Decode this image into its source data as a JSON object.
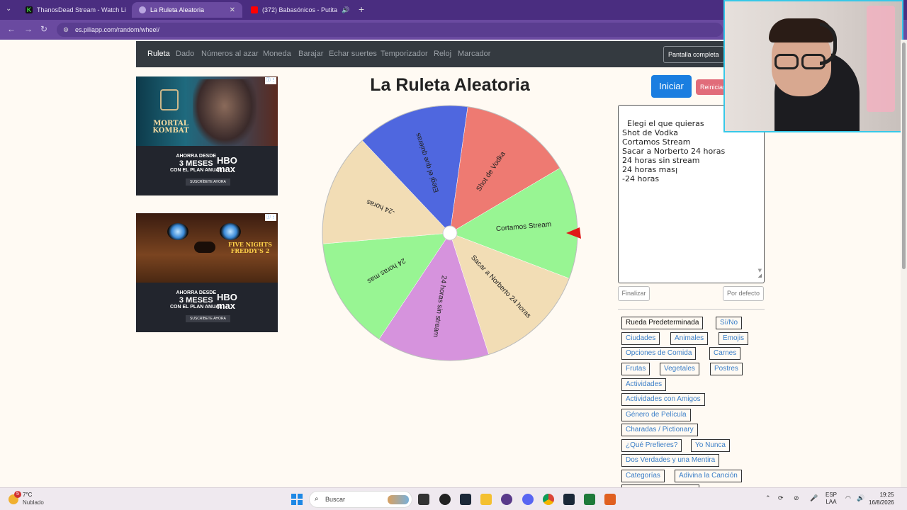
{
  "browser": {
    "tabs": [
      {
        "title": "ThanosDead Stream - Watch Li",
        "active": false,
        "color": "#3dd63d"
      },
      {
        "title": "La Ruleta Aleatoria",
        "active": true,
        "color": "#b9a6e0"
      },
      {
        "title": "(372) Babasónicos - Putita",
        "active": false,
        "color": "#ff0000"
      }
    ],
    "url": "es.piliapp.com/random/wheel/"
  },
  "site_nav": {
    "items": [
      "Ruleta",
      "Dado",
      "Números al azar",
      "Moneda",
      "Barajar",
      "Echar suertes",
      "Temporizador",
      "Reloj",
      "Marcador"
    ],
    "current": "Ruleta",
    "fullscreen_label": "Pantalla completa"
  },
  "ads": [
    {
      "headline": "MORTAL KOMBAT",
      "promo_line1": "AHORRA DESDE",
      "promo_line2": "3 MESES",
      "promo_line3": "CON EL PLAN ANUAL",
      "brand1": "HBO",
      "brand2": "max",
      "cta": "SUSCRÍBETE AHORA"
    },
    {
      "headline": "FIVE NIGHTS FREDDY'S 2",
      "promo_line1": "AHORRA DESDE",
      "promo_line2": "3 MESES",
      "promo_line3": "CON EL PLAN ANUAL",
      "brand1": "HBO",
      "brand2": "max",
      "cta": "SUSCRÍBETE AHORA"
    }
  ],
  "main": {
    "title": "La Ruleta Aleatoria",
    "start_label": "Iniciar",
    "reset_label": "Reiniciar",
    "entries_text": "Elegi el que quieras\nShot de Vodka\nCortamos Stream\nSacar a Norberto 24 horas\n24 horas sin stream\n24 horas mas\n-24 horas",
    "finish_label": "Finalizar",
    "default_label": "Por defecto"
  },
  "wheel": {
    "segments": [
      {
        "label": "Shot de Vodka",
        "color": "#ee7a72"
      },
      {
        "label": "Cortamos Stream",
        "color": "#98f593"
      },
      {
        "label": "Sacar a Norberto 24 horas",
        "color": "#f2ddb5"
      },
      {
        "label": "24 horas sin stream",
        "color": "#d693dd"
      },
      {
        "label": "24 horas mas",
        "color": "#98f593"
      },
      {
        "label": "-24 horas",
        "color": "#f2ddb5"
      },
      {
        "label": "Elegi el que quieras",
        "color": "#4f67df"
      }
    ],
    "pointer_color": "#e01818"
  },
  "presets": [
    {
      "label": "Rueda Predeterminada",
      "selected": true
    },
    {
      "label": "Sí/No",
      "selected": false
    },
    {
      "label": "Ciudades",
      "selected": false
    },
    {
      "label": "Animales",
      "selected": false
    },
    {
      "label": "Emojis",
      "selected": false
    },
    {
      "label": "Opciones de Comida",
      "selected": false
    },
    {
      "label": "Carnes",
      "selected": false
    },
    {
      "label": "Frutas",
      "selected": false
    },
    {
      "label": "Vegetales",
      "selected": false
    },
    {
      "label": "Postres",
      "selected": false
    },
    {
      "label": "Actividades",
      "selected": false
    },
    {
      "label": "Actividades con Amigos",
      "selected": false
    },
    {
      "label": "Género de Película",
      "selected": false
    },
    {
      "label": "Charadas / Pictionary",
      "selected": false
    },
    {
      "label": "¿Qué Prefieres?",
      "selected": false
    },
    {
      "label": "Yo Nunca",
      "selected": false
    },
    {
      "label": "Dos Verdades y una Mentira",
      "selected": false
    },
    {
      "label": "Categorías",
      "selected": false
    },
    {
      "label": "Adivina la Canción",
      "selected": false
    }
  ],
  "taskbar": {
    "weather_temp": "7°C",
    "weather_cond": "Nublado",
    "weather_badge": "5",
    "search_placeholder": "Buscar",
    "lang1": "ESP",
    "lang2": "LAA",
    "time": "19:25",
    "date": "16/8/2026"
  }
}
